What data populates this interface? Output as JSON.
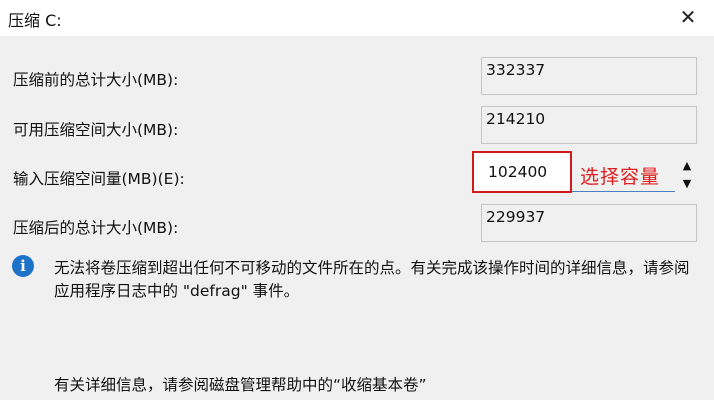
{
  "window": {
    "title": "压缩 C:",
    "close_glyph": "✕"
  },
  "rows": {
    "total_before_label": "压缩前的总计大小(MB):",
    "total_before_value": "332337",
    "available_label": "可用压缩空间大小(MB):",
    "available_value": "214210",
    "input_label": "输入压缩空间量(MB)(E):",
    "input_value": "102400",
    "total_after_label": "压缩后的总计大小(MB):",
    "total_after_value": "229937"
  },
  "annotation": {
    "text": "选择容量",
    "color": "#e01d1d"
  },
  "spinner": {
    "up_glyph": "▲",
    "down_glyph": "▼"
  },
  "info": {
    "icon_glyph": "i",
    "icon_color": "#1e73c9",
    "message": "无法将卷压缩到超出任何不可移动的文件所在的点。有关完成该操作时间的详细信息，请参阅应用程序日志中的 \"defrag\" 事件。"
  },
  "help": {
    "text": "有关详细信息，请参阅磁盘管理帮助中的“收缩基本卷”"
  }
}
